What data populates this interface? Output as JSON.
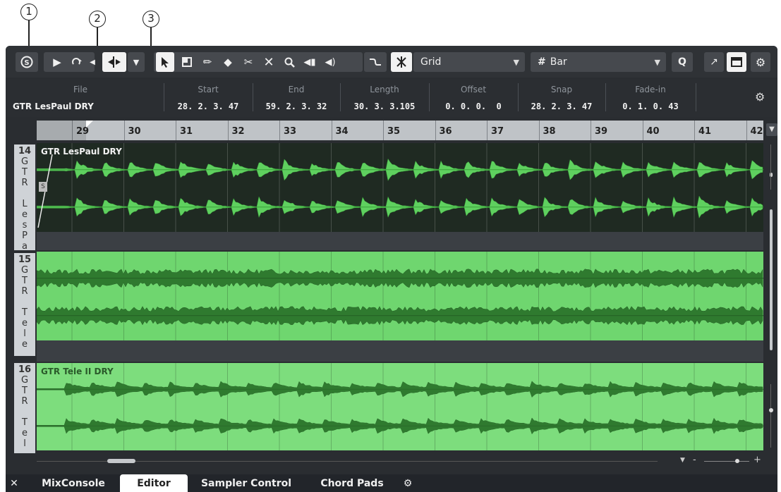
{
  "callouts": [
    "1",
    "2",
    "3"
  ],
  "toolbar": {
    "tools": [
      "solo-icon",
      "play-icon",
      "loop-icon",
      "auto-scroll-icon",
      "object-select-icon",
      "range-select-icon",
      "draw-icon",
      "erase-icon",
      "split-icon",
      "mute-icon",
      "zoom-icon",
      "audition-icon",
      "speaker-icon",
      "snap-icon",
      "grid-icon"
    ],
    "grid_label": "Grid",
    "quantize_label": "Bar",
    "q_label": "Q"
  },
  "info_line": {
    "columns": [
      {
        "header": "File",
        "value": "GTR LesPaul DRY"
      },
      {
        "header": "Start",
        "value": "28. 2. 3. 47"
      },
      {
        "header": "End",
        "value": "59. 2. 3. 32"
      },
      {
        "header": "Length",
        "value": "30. 3. 3.105"
      },
      {
        "header": "Offset",
        "value": "0. 0. 0.  0"
      },
      {
        "header": "Snap",
        "value": "28. 2. 3. 47"
      },
      {
        "header": "Fade-in",
        "value": "0. 1. 0. 43"
      }
    ]
  },
  "ruler": {
    "bars": [
      "29",
      "30",
      "31",
      "32",
      "33",
      "34",
      "35",
      "36",
      "37",
      "38",
      "39",
      "40",
      "41",
      "42"
    ]
  },
  "tracks": [
    {
      "number": "14",
      "chars": [
        "G",
        "T",
        "R",
        "",
        "L",
        "e",
        "s",
        "P",
        "a"
      ],
      "event": "GTR LesPaul DRY"
    },
    {
      "number": "15",
      "chars": [
        "G",
        "T",
        "R",
        "",
        "T",
        "e",
        "l",
        "e"
      ],
      "event": ""
    },
    {
      "number": "16",
      "chars": [
        "G",
        "T",
        "R",
        "",
        "T",
        "e",
        "l"
      ],
      "event": "GTR Tele II DRY"
    }
  ],
  "tabs": {
    "close": "✕",
    "items": [
      "MixConsole",
      "Editor",
      "Sampler Control",
      "Chord Pads"
    ],
    "active": "Editor"
  },
  "colors": {
    "accent": "#5fd05f",
    "waveform_dark": "#2f7a2f",
    "lane_selected": "#6fd66f",
    "lane_dark": "#1f2a22"
  }
}
